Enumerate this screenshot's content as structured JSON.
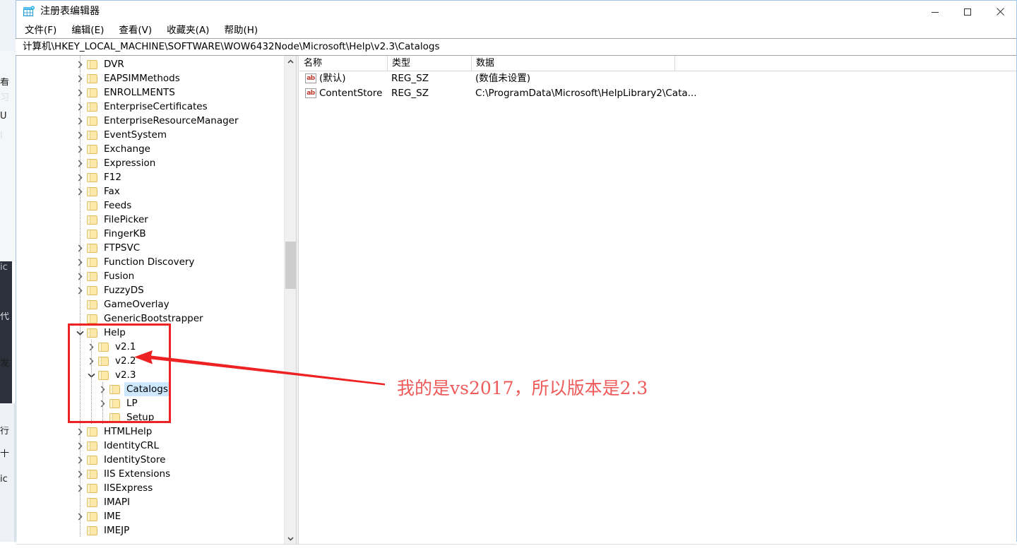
{
  "window": {
    "title": "注册表编辑器",
    "icon": "regedit-icon",
    "controls": {
      "minimize": "最小化",
      "maximize": "最大化",
      "close": "关闭"
    }
  },
  "menubar": {
    "items": [
      {
        "label": "文件(F)",
        "name": "menu-file"
      },
      {
        "label": "编辑(E)",
        "name": "menu-edit"
      },
      {
        "label": "查看(V)",
        "name": "menu-view"
      },
      {
        "label": "收藏夹(A)",
        "name": "menu-favorites"
      },
      {
        "label": "帮助(H)",
        "name": "menu-help"
      }
    ]
  },
  "address": {
    "path": "计算机\\HKEY_LOCAL_MACHINE\\SOFTWARE\\WOW6432Node\\Microsoft\\Help\\v2.3\\Catalogs"
  },
  "tree": {
    "nodes": [
      {
        "label": "DVR",
        "depth": 1,
        "expander": "collapsed",
        "selected": false
      },
      {
        "label": "EAPSIMMethods",
        "depth": 1,
        "expander": "collapsed",
        "selected": false
      },
      {
        "label": "ENROLLMENTS",
        "depth": 1,
        "expander": "collapsed",
        "selected": false
      },
      {
        "label": "EnterpriseCertificates",
        "depth": 1,
        "expander": "collapsed",
        "selected": false
      },
      {
        "label": "EnterpriseResourceManager",
        "depth": 1,
        "expander": "collapsed",
        "selected": false
      },
      {
        "label": "EventSystem",
        "depth": 1,
        "expander": "collapsed",
        "selected": false
      },
      {
        "label": "Exchange",
        "depth": 1,
        "expander": "collapsed",
        "selected": false
      },
      {
        "label": "Expression",
        "depth": 1,
        "expander": "collapsed",
        "selected": false
      },
      {
        "label": "F12",
        "depth": 1,
        "expander": "collapsed",
        "selected": false
      },
      {
        "label": "Fax",
        "depth": 1,
        "expander": "collapsed",
        "selected": false
      },
      {
        "label": "Feeds",
        "depth": 1,
        "expander": "none",
        "selected": false
      },
      {
        "label": "FilePicker",
        "depth": 1,
        "expander": "none",
        "selected": false
      },
      {
        "label": "FingerKB",
        "depth": 1,
        "expander": "none",
        "selected": false
      },
      {
        "label": "FTPSVC",
        "depth": 1,
        "expander": "collapsed",
        "selected": false
      },
      {
        "label": "Function Discovery",
        "depth": 1,
        "expander": "collapsed",
        "selected": false
      },
      {
        "label": "Fusion",
        "depth": 1,
        "expander": "collapsed",
        "selected": false
      },
      {
        "label": "FuzzyDS",
        "depth": 1,
        "expander": "collapsed",
        "selected": false
      },
      {
        "label": "GameOverlay",
        "depth": 1,
        "expander": "none",
        "selected": false
      },
      {
        "label": "GenericBootstrapper",
        "depth": 1,
        "expander": "none",
        "selected": false
      },
      {
        "label": "Help",
        "depth": 1,
        "expander": "expanded",
        "selected": false
      },
      {
        "label": "v2.1",
        "depth": 2,
        "expander": "collapsed",
        "selected": false
      },
      {
        "label": "v2.2",
        "depth": 2,
        "expander": "collapsed",
        "selected": false
      },
      {
        "label": "v2.3",
        "depth": 2,
        "expander": "expanded",
        "selected": false
      },
      {
        "label": "Catalogs",
        "depth": 3,
        "expander": "collapsed",
        "selected": true
      },
      {
        "label": "LP",
        "depth": 3,
        "expander": "collapsed",
        "selected": false
      },
      {
        "label": "Setup",
        "depth": 3,
        "expander": "none",
        "selected": false
      },
      {
        "label": "HTMLHelp",
        "depth": 1,
        "expander": "collapsed",
        "selected": false
      },
      {
        "label": "IdentityCRL",
        "depth": 1,
        "expander": "collapsed",
        "selected": false
      },
      {
        "label": "IdentityStore",
        "depth": 1,
        "expander": "collapsed",
        "selected": false
      },
      {
        "label": "IIS Extensions",
        "depth": 1,
        "expander": "collapsed",
        "selected": false
      },
      {
        "label": "IISExpress",
        "depth": 1,
        "expander": "collapsed",
        "selected": false
      },
      {
        "label": "IMAPI",
        "depth": 1,
        "expander": "none",
        "selected": false
      },
      {
        "label": "IME",
        "depth": 1,
        "expander": "collapsed",
        "selected": false
      },
      {
        "label": "IMEJP",
        "depth": 1,
        "expander": "none",
        "selected": false
      }
    ]
  },
  "list": {
    "columns": [
      {
        "label": "名称",
        "name": "column-name"
      },
      {
        "label": "类型",
        "name": "column-type"
      },
      {
        "label": "数据",
        "name": "column-data"
      }
    ],
    "rows": [
      {
        "icon": "string-value-icon",
        "icon_text": "ab",
        "name": "(默认)",
        "type": "REG_SZ",
        "data": "(数值未设置)"
      },
      {
        "icon": "string-value-icon",
        "icon_text": "ab",
        "name": "ContentStore",
        "type": "REG_SZ",
        "data": "C:\\ProgramData\\Microsoft\\HelpLibrary2\\Cata..."
      }
    ]
  },
  "annotations": {
    "note_text": "我的是vs2017，所以版本是2.3",
    "note_color": "#ef5a5a",
    "box_color": "#ee2222",
    "arrow_color": "#ee2222"
  },
  "background_window": {
    "fragments": [
      "看",
      "习",
      "U",
      "l",
      "ic",
      "代",
      "发",
      "行",
      "十",
      "ic"
    ]
  },
  "colors": {
    "selection_blue": "#cde8ff",
    "folder_yellow": "#fce8a8",
    "window_border": "#a5c5e6",
    "scrollbar_thumb": "#cdcdcd"
  }
}
